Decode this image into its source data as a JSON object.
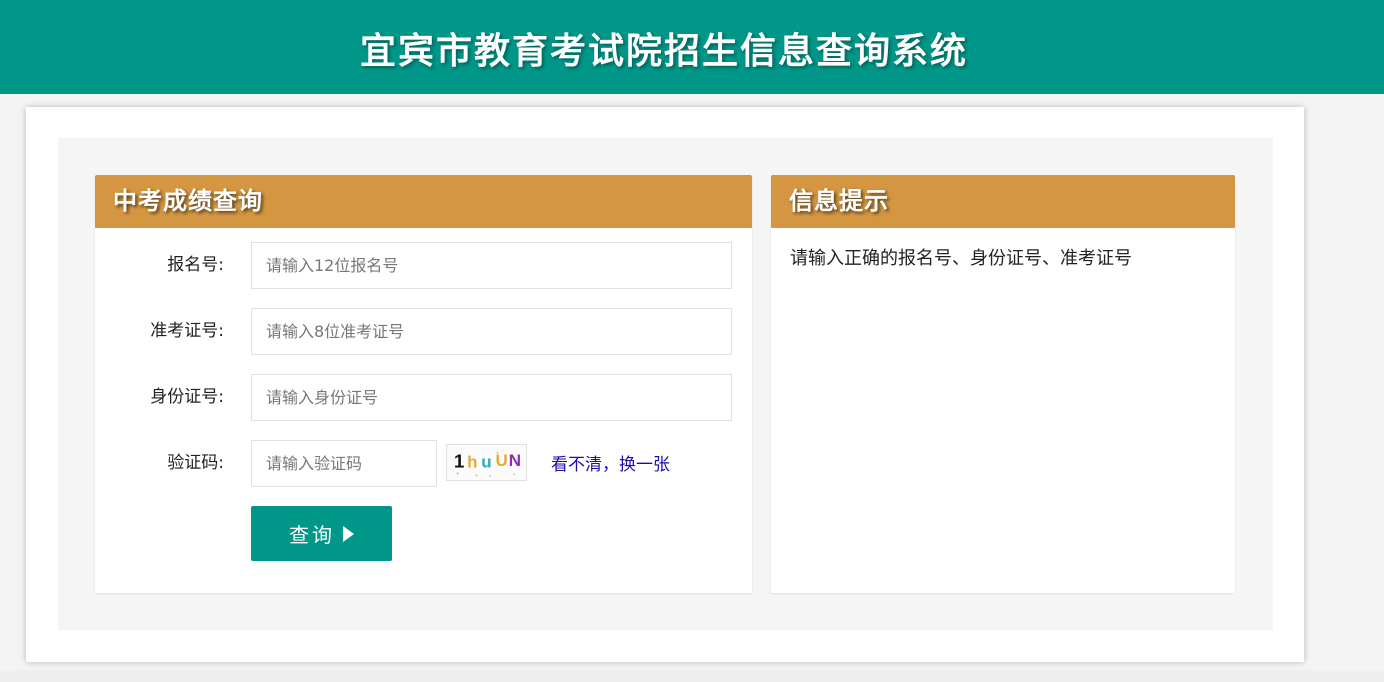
{
  "header": {
    "title": "宜宾市教育考试院招生信息查询系统",
    "color": "#009688"
  },
  "query_panel": {
    "title": "中考成绩查询",
    "header_color": "#d49641",
    "fields": [
      {
        "label": "报名号:",
        "placeholder": "请输入12位报名号",
        "value": ""
      },
      {
        "label": "准考证号:",
        "placeholder": "请输入8位准考证号",
        "value": ""
      },
      {
        "label": "身份证号:",
        "placeholder": "请输入身份证号",
        "value": ""
      }
    ],
    "captcha": {
      "label": "验证码:",
      "placeholder": "请输入验证码",
      "value": "",
      "image_text": "1huUN",
      "refresh_link": "看不清，换一张"
    },
    "submit_label": "查询",
    "submit_icon": "play-icon"
  },
  "info_panel": {
    "title": "信息提示",
    "message": "请输入正确的报名号、身份证号、准考证号"
  }
}
